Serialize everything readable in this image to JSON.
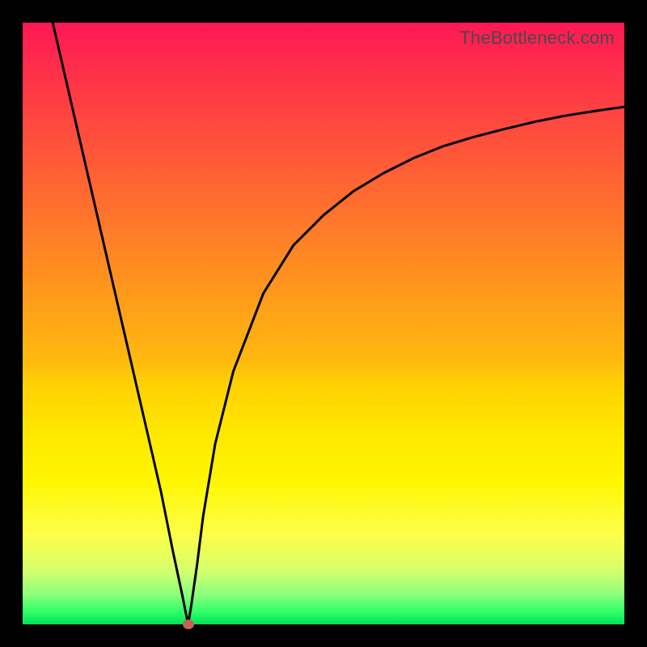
{
  "attribution": "TheBottleneck.com",
  "chart_data": {
    "type": "line",
    "title": "",
    "xlabel": "",
    "ylabel": "",
    "xlim": [
      0,
      100
    ],
    "ylim": [
      0,
      100
    ],
    "gradient_stops": [
      {
        "pos": 0,
        "color": "#ff1854"
      },
      {
        "pos": 40,
        "color": "#ff8b22"
      },
      {
        "pos": 70,
        "color": "#ffe700"
      },
      {
        "pos": 95,
        "color": "#8dff7d"
      },
      {
        "pos": 100,
        "color": "#00e05a"
      }
    ],
    "series": [
      {
        "name": "left-branch",
        "x": [
          5,
          8,
          11,
          14,
          17,
          20,
          23,
          25,
          26.5,
          27,
          27.5
        ],
        "y": [
          100,
          87,
          74,
          61,
          48,
          35,
          22,
          12,
          5,
          2.5,
          0
        ]
      },
      {
        "name": "right-branch",
        "x": [
          27.5,
          28,
          29,
          30,
          32,
          35,
          40,
          45,
          50,
          55,
          60,
          65,
          70,
          75,
          80,
          85,
          90,
          95,
          100
        ],
        "y": [
          0,
          3,
          10,
          18,
          30,
          42,
          55,
          63,
          68,
          72,
          75,
          77.5,
          79.5,
          81,
          82.3,
          83.5,
          84.5,
          85.3,
          86
        ]
      }
    ],
    "marker": {
      "x": 27.5,
      "y": 0,
      "color": "#c86058"
    }
  }
}
